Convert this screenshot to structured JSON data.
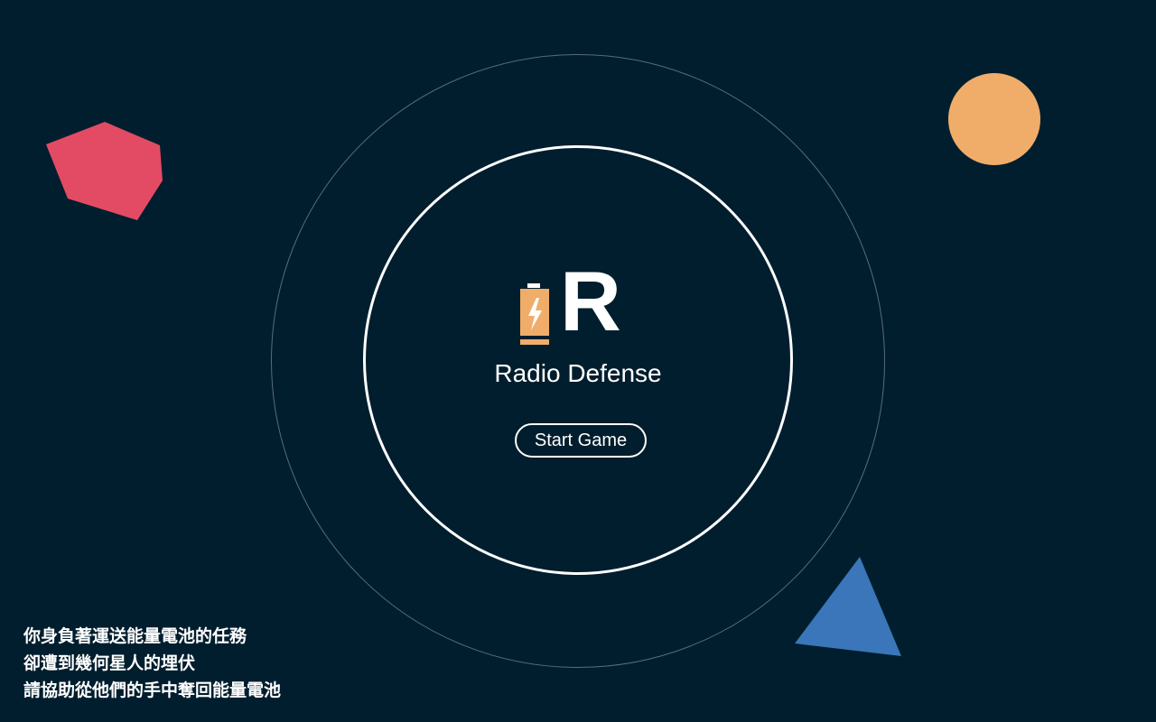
{
  "colors": {
    "background": "#011e2e",
    "battery": "#f0ad6a",
    "pentagon": "#e34b64",
    "circle": "#f0ad6a",
    "triangle": "#3a76b9",
    "ring_outer": "rgba(255,255,255,0.35)",
    "ring_inner": "#ffffff"
  },
  "logo": {
    "icon": "battery-bolt-icon",
    "letter": "R"
  },
  "title": "Radio Defense",
  "start_button": {
    "label": "Start Game"
  },
  "story": {
    "lines": [
      "你身負著運送能量電池的任務",
      "卻遭到幾何星人的埋伏",
      "請協助從他們的手中奪回能量電池"
    ]
  },
  "decorations": {
    "shapes": [
      "pentagon-shape",
      "circle-shape",
      "triangle-shape"
    ]
  }
}
